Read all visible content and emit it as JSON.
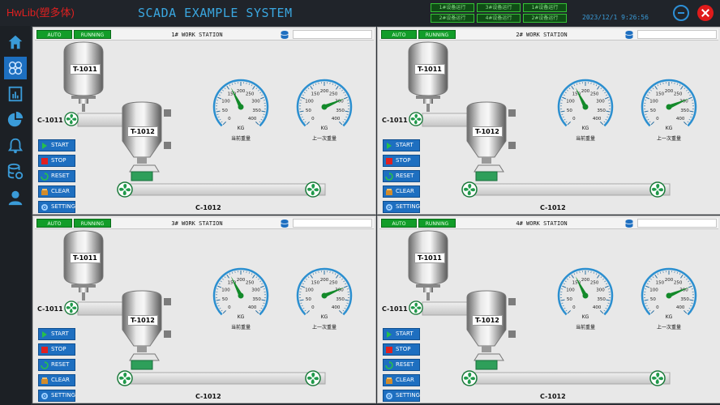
{
  "header": {
    "logo": "HwLib(塑多体)",
    "title": "SCADA EXAMPLE SYSTEM",
    "station_buttons": [
      "1#设备运行",
      "3#设备运行",
      "1#设备运行",
      "2#设备运行",
      "4#设备运行",
      "2#设备运行"
    ],
    "datetime": "2023/12/1  9:26:56"
  },
  "sidebar": {
    "items": [
      "home",
      "grid",
      "report",
      "chart",
      "alarm",
      "database",
      "user"
    ]
  },
  "stations": [
    {
      "auto": "AUTO",
      "running": "RUNNING",
      "title": "1# WORK STATION",
      "tank1": "T-1011",
      "tank2": "T-1012",
      "conv1": "C-1011",
      "conv2": "C-1012",
      "gauge1_unit": "KG",
      "gauge2_unit": "KG",
      "gauge1_caption": "当前重量",
      "gauge2_caption": "上一次重量",
      "gauge1_value": 160,
      "gauge2_value": 300
    },
    {
      "auto": "AUTO",
      "running": "RUNNING",
      "title": "2# WORK STATION",
      "tank1": "T-1011",
      "tank2": "T-1012",
      "conv1": "C-1011",
      "conv2": "C-1012",
      "gauge1_unit": "KG",
      "gauge2_unit": "KG",
      "gauge1_caption": "当前重量",
      "gauge2_caption": "上一次重量",
      "gauge1_value": 160,
      "gauge2_value": 300
    },
    {
      "auto": "AUTO",
      "running": "RUNNING",
      "title": "3# WORK STATION",
      "tank1": "T-1011",
      "tank2": "T-1012",
      "conv1": "C-1011",
      "conv2": "C-1012",
      "gauge1_unit": "KG",
      "gauge2_unit": "KG",
      "gauge1_caption": "当前重量",
      "gauge2_caption": "上一次重量",
      "gauge1_value": 160,
      "gauge2_value": 300
    },
    {
      "auto": "AUTO",
      "running": "RUNNING",
      "title": "4# WORK STATION",
      "tank1": "T-1011",
      "tank2": "T-1012",
      "conv1": "C-1011",
      "conv2": "C-1012",
      "gauge1_unit": "KG",
      "gauge2_unit": "KG",
      "gauge1_caption": "当前重量",
      "gauge2_caption": "上一次重量",
      "gauge1_value": 160,
      "gauge2_value": 300
    }
  ],
  "controls": {
    "start": "START",
    "stop": "STOP",
    "reset": "RESET",
    "clear": "CLEAR",
    "setting": "SETTING"
  },
  "gauge_ticks": [
    "0",
    "50",
    "100",
    "150",
    "200",
    "250",
    "300",
    "350",
    "400"
  ],
  "colors": {
    "accent": "#1e6fc0",
    "running": "#129d29",
    "needle": "#138a2a",
    "gauge_arc": "#2b8fd0"
  }
}
